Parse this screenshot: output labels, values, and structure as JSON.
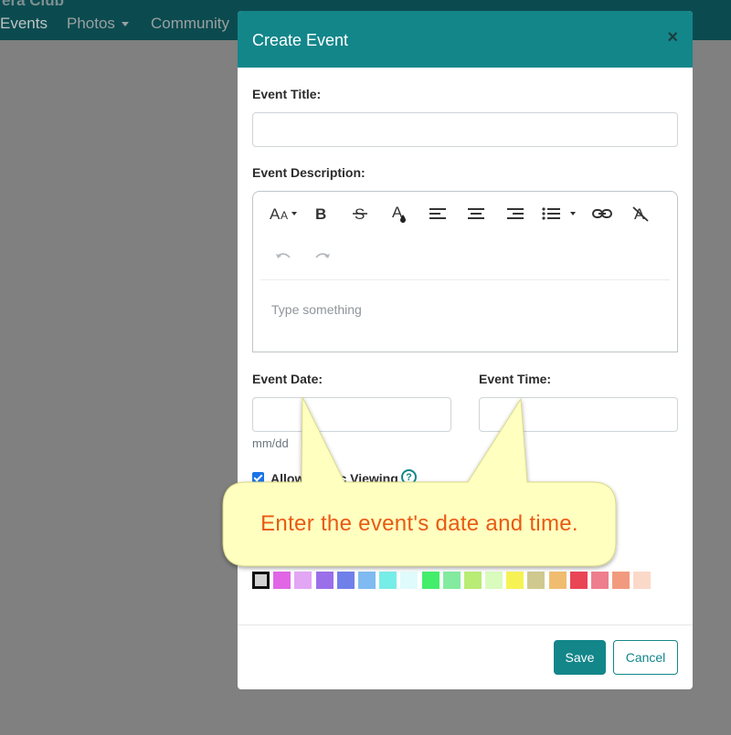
{
  "navbar": {
    "brand": "era Club",
    "items": [
      "Events",
      "Photos",
      "Community"
    ]
  },
  "modal": {
    "title": "Create Event",
    "close_symbol": "×",
    "event_title_label": "Event Title:",
    "event_title_value": "",
    "event_description_label": "Event Description:",
    "editor_placeholder": "Type something",
    "event_date_label": "Event Date:",
    "event_date_value": "",
    "event_date_hint": "mm/dd",
    "event_time_label": "Event Time:",
    "event_time_value": "",
    "public_viewing_label": "Allow Public Viewing",
    "help_symbol": "?",
    "save_label": "Save",
    "cancel_label": "Cancel"
  },
  "editor_toolbar": {
    "font_size_icon": "font-size-icon",
    "bold_icon": "bold-icon",
    "strikethrough_icon": "strikethrough-icon",
    "text_color_icon": "text-color-icon",
    "align_left_icon": "align-left-icon",
    "align_center_icon": "align-center-icon",
    "align_right_icon": "align-right-icon",
    "list_icon": "list-icon",
    "link_icon": "link-icon",
    "clear_format_icon": "clear-format-icon",
    "undo_icon": "undo-icon",
    "redo_icon": "redo-icon"
  },
  "color_swatches": [
    "#d3d3d3",
    "#e066e6",
    "#e2a6f5",
    "#9b6fea",
    "#7080ea",
    "#7fbbf0",
    "#77ede8",
    "#e0fbfb",
    "#44ee6b",
    "#83eb9f",
    "#b9ec74",
    "#d9fbbd",
    "#f7f254",
    "#cfc98f",
    "#f0bd70",
    "#ea4555",
    "#ee7e8d",
    "#f29a7e",
    "#fbd9c9"
  ],
  "selected_color": "#d3d3d3",
  "tooltip": {
    "text": "Enter the event's date and time."
  },
  "colors": {
    "brand_teal": "#13868a",
    "tooltip_fill": "#ffffc0",
    "tooltip_text": "#e85a14"
  }
}
